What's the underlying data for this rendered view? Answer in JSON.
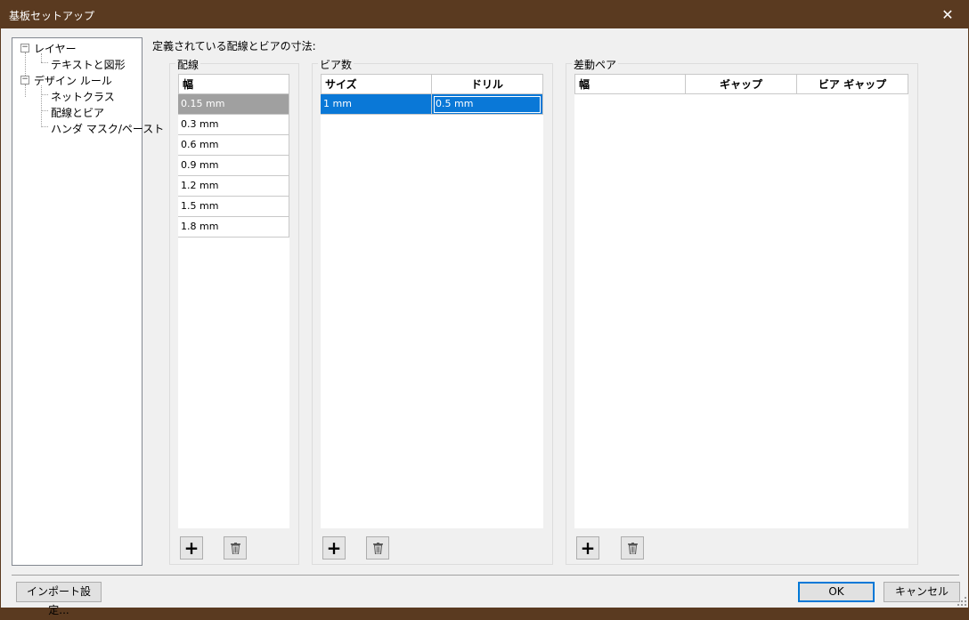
{
  "window": {
    "title": "基板セットアップ",
    "close_icon": "close-icon"
  },
  "tree": {
    "layers": "レイヤー",
    "text_and_graphics": "テキストと図形",
    "design_rules": "デザイン ルール",
    "net_classes": "ネットクラス",
    "tracks_and_vias": "配線とビア",
    "solder_mask_paste": "ハンダ マスク/ペースト"
  },
  "heading": "定義されている配線とビアの寸法:",
  "tracks": {
    "label": "配線",
    "header": "幅",
    "rows": [
      "0.15 mm",
      "0.3 mm",
      "0.6 mm",
      "0.9 mm",
      "1.2 mm",
      "1.5 mm",
      "1.8 mm"
    ]
  },
  "vias": {
    "label": "ビア数",
    "headers": [
      "サイズ",
      "ドリル"
    ],
    "rows": [
      [
        "1 mm",
        "0.5 mm"
      ]
    ]
  },
  "diff_pairs": {
    "label": "差動ペア",
    "headers": [
      "幅",
      "ギャップ",
      "ビア ギャップ"
    ]
  },
  "footer": {
    "import_button": "インポート設定...",
    "ok_button": "OK",
    "cancel_button": "キャンセル"
  },
  "colors": {
    "titlebar": "#5a3a20",
    "selection_blue": "#0a78d7",
    "selection_gray": "#a0a0a0"
  }
}
